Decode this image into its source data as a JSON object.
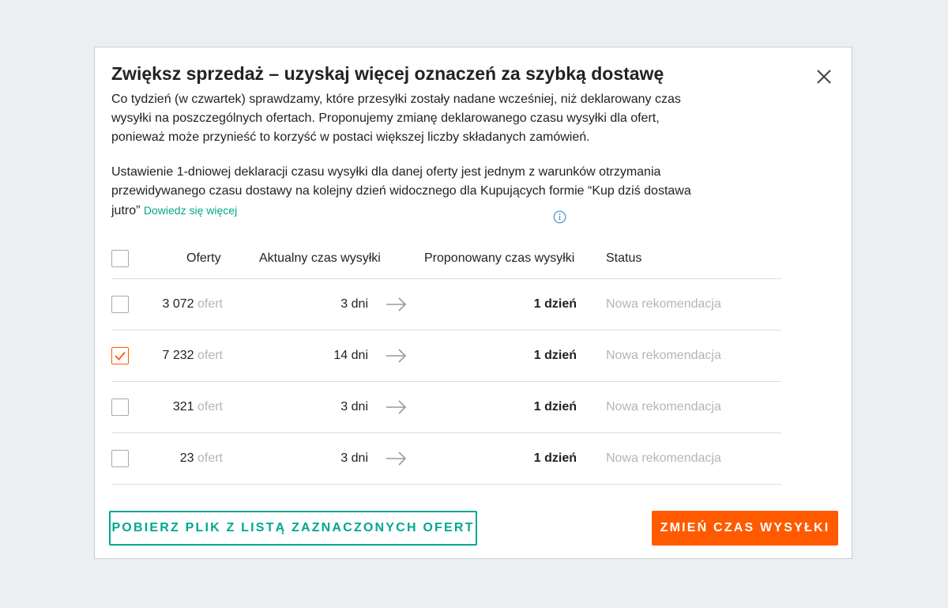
{
  "modal": {
    "title": "Zwiększ sprzedaż – uzyskaj więcej oznaczeń za szybką dostawę",
    "description": "Co tydzień (w czwartek) sprawdzamy, które przesyłki zostały nadane wcześniej, niż deklarowany czas wysyłki na poszczególnych ofertach. Proponujemy zmianę deklarowanego czasu wysyłki dla ofert, ponieważ może przynieść to korzyść w postaci większej liczby składanych zamówień.",
    "description2": "Ustawienie 1-dniowej deklaracji czasu wysyłki dla danej oferty jest jednym z warunków otrzymania przewidywanego czasu dostawy na kolejny dzień widocznego dla Kupujących formie “Kup dziś dostawa jutro”",
    "learn_more_link": "Dowiedz się więcej",
    "close_icon": "close-icon",
    "info_icon": "info-icon"
  },
  "table": {
    "headers": {
      "offers": "Oferty",
      "current": "Aktualny czas wysyłki",
      "proposed": "Proponowany czas wysyłki",
      "status": "Status"
    },
    "rows": [
      {
        "count": "3 072",
        "unit": "ofert",
        "current": "3 dni",
        "proposed": "1 dzień",
        "status": "Nowa rekomendacja",
        "checked": false
      },
      {
        "count": "7 232",
        "unit": "ofert",
        "current": "14 dni",
        "proposed": "1 dzień",
        "status": "Nowa rekomendacja",
        "checked": true
      },
      {
        "count": "321",
        "unit": "ofert",
        "current": "3 dni",
        "proposed": "1 dzień",
        "status": "Nowa rekomendacja",
        "checked": false
      },
      {
        "count": "23",
        "unit": "ofert",
        "current": "3 dni",
        "proposed": "1 dzień",
        "status": "Nowa rekomendacja",
        "checked": false
      }
    ]
  },
  "buttons": {
    "download": "POBIERZ PLIK Z LISTĄ ZAZNACZONYCH OFERT",
    "change": "ZMIEŃ CZAS WYSYŁKI"
  },
  "colors": {
    "accent_orange": "#ff5a00",
    "accent_teal": "#00a790",
    "info_blue": "#3d8fd1",
    "background": "#eceff2"
  }
}
